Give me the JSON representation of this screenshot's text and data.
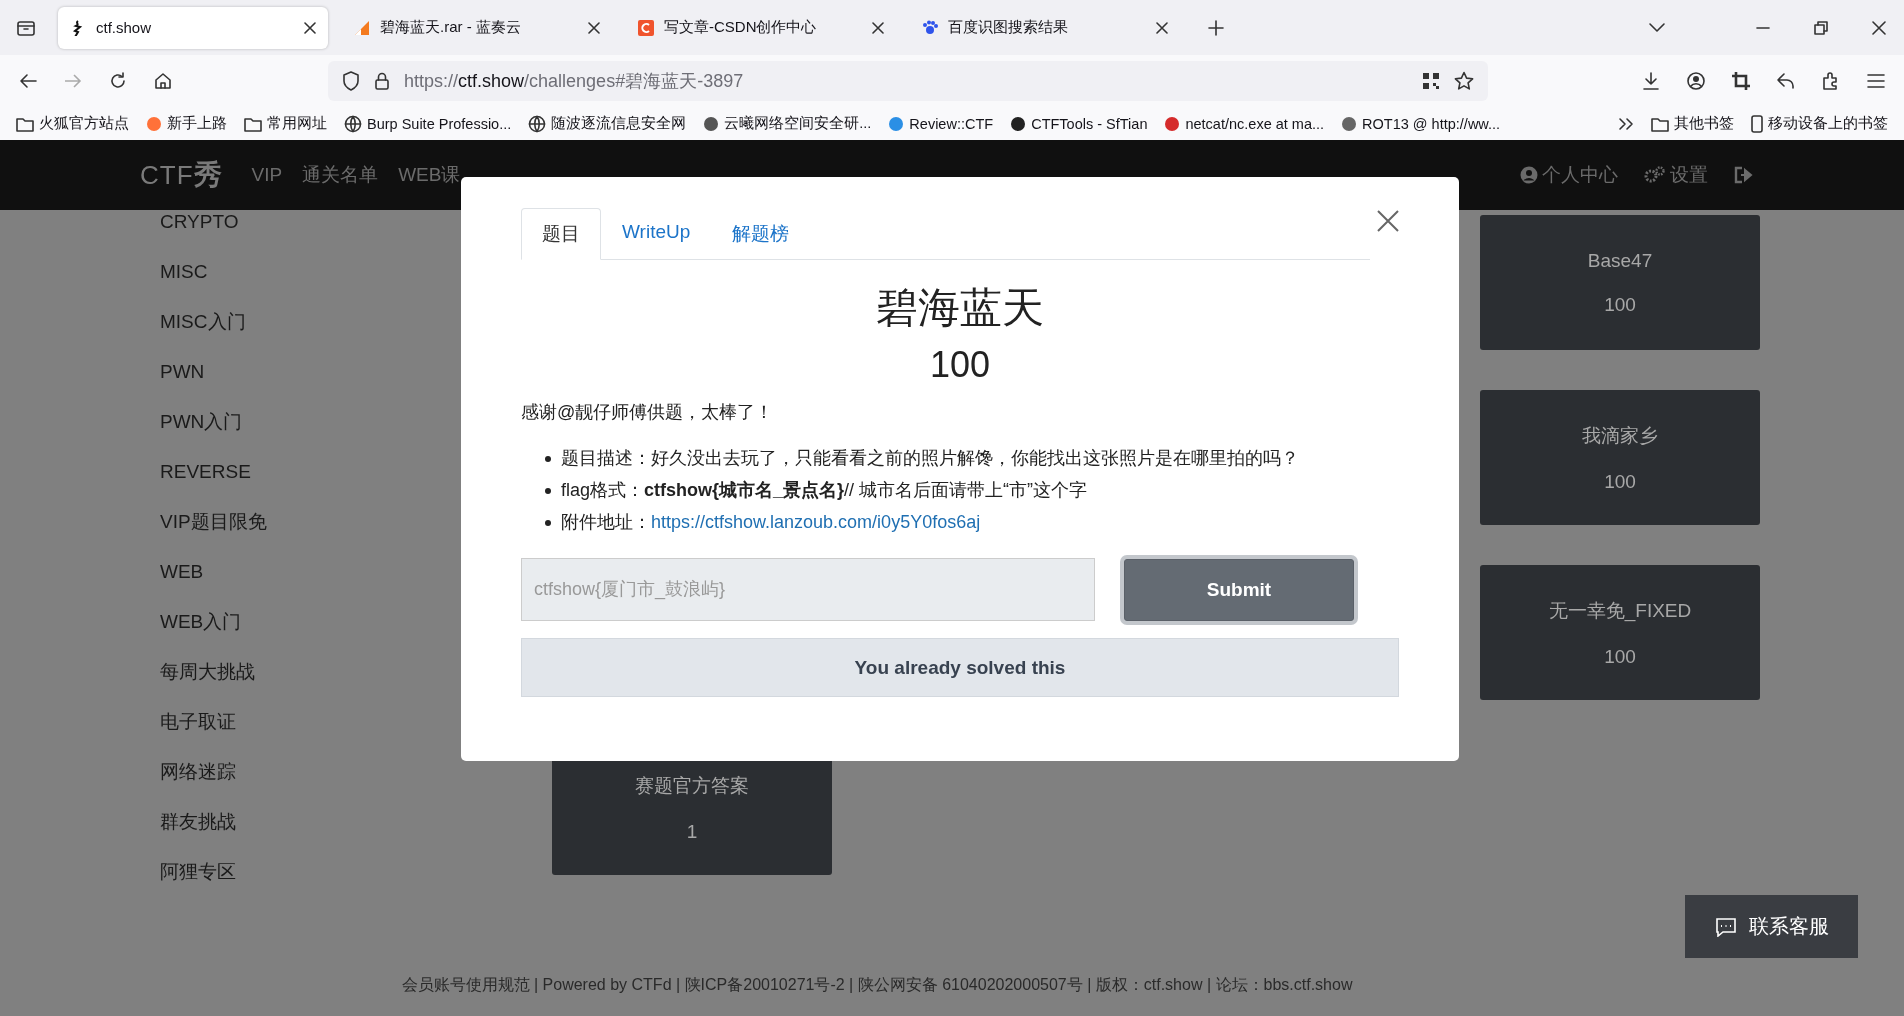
{
  "browser": {
    "tabs": [
      {
        "title": "ctf.show",
        "selected": true
      },
      {
        "title": "碧海蓝天.rar - 蓝奏云",
        "selected": false
      },
      {
        "title": "写文章-CSDN创作中心",
        "selected": false
      },
      {
        "title": "百度识图搜索结果",
        "selected": false
      }
    ],
    "address": {
      "prefix": "https://",
      "host": "ctf.show",
      "path": "/challenges#碧海蓝天-3897"
    },
    "bookmarks": [
      {
        "label": "火狐官方站点",
        "kind": "folder"
      },
      {
        "label": "新手上路",
        "kind": "favicon"
      },
      {
        "label": "常用网址",
        "kind": "folder"
      },
      {
        "label": "Burp Suite Professio...",
        "kind": "globe"
      },
      {
        "label": "随波逐流信息安全网",
        "kind": "globe"
      },
      {
        "label": "云曦网络空间安全研...",
        "kind": "favicon"
      },
      {
        "label": "Review::CTF",
        "kind": "favicon"
      },
      {
        "label": "CTFTools - SfTian",
        "kind": "favicon"
      },
      {
        "label": "netcat/nc.exe at ma...",
        "kind": "favicon"
      },
      {
        "label": "ROT13 @ http://ww...",
        "kind": "favicon"
      }
    ],
    "other_bookmarks": [
      {
        "label": "其他书签",
        "kind": "folder"
      },
      {
        "label": "移动设备上的书签",
        "kind": "phone"
      }
    ]
  },
  "site_nav": {
    "logo": "CTF",
    "logo_mark": "秀",
    "items": [
      "VIP",
      "通关名单",
      "WEB课"
    ],
    "user_menu": [
      "个人中心",
      "设置"
    ]
  },
  "categories": [
    "CRYPTO",
    "MISC",
    "MISC入门",
    "PWN",
    "PWN入门",
    "REVERSE",
    "VIP题目限免",
    "WEB",
    "WEB入门",
    "每周大挑战",
    "电子取证",
    "网络迷踪",
    "群友挑战",
    "阿狸专区"
  ],
  "challenge_cards_right": [
    {
      "name": "Base47",
      "value": "100"
    },
    {
      "name": "我滴家乡",
      "value": "100"
    },
    {
      "name": "无一幸免_FIXED",
      "value": "100"
    }
  ],
  "challenge_cards_bottom": [
    {
      "name": "赛题官方答案",
      "value": "1"
    }
  ],
  "modal": {
    "tabs": [
      {
        "label": "题目",
        "selected": true
      },
      {
        "label": "WriteUp",
        "selected": false
      },
      {
        "label": "解题榜",
        "selected": false
      }
    ],
    "title": "碧海蓝天",
    "value": "100",
    "intro": "感谢@靓仔师傅供题，太棒了！",
    "bullets": [
      {
        "text": "题目描述：好久没出去玩了，只能看看之前的照片解馋，你能找出这张照片是在哪里拍的吗？"
      },
      {
        "text": "flag格式：**ctfshow{城市名_景点名}**// 城市名后面请带上“市”这个字"
      },
      {
        "text": "附件地址：",
        "link": "https://ctfshow.lanzoub.com/i0y5Y0fos6aj"
      }
    ],
    "answer": {
      "placeholder": "ctfshow{厦门市_鼓浪屿}",
      "disabled": true
    },
    "submit": "Submit",
    "solved_message": "You already solved this"
  },
  "footer": "会员账号使用规范 | Powered by CTFd | 陕ICP备20010271号-2 | 陕公网安备 61040202000507号 | 版权：ctf.show | 论坛：bbs.ctf.show",
  "contact_button": "联系客服"
}
